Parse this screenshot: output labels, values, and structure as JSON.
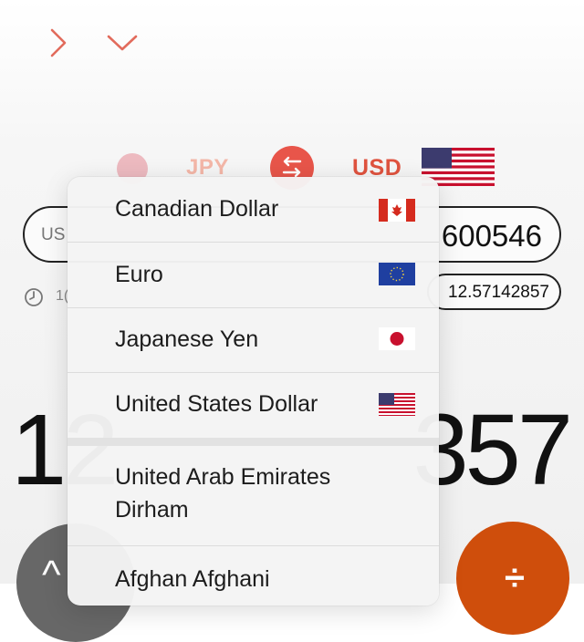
{
  "nav": {
    "forward_icon": "chevron-right-icon",
    "expand_icon": "chevron-down-icon"
  },
  "converter": {
    "from_code": "JPY",
    "to_code": "USD",
    "swap_icon": "swap-arrows-icon",
    "amount_prefix": "US",
    "amount_value": "600546",
    "rate_prefix": "1(",
    "rate_value": "12.57142857",
    "big_left": "12",
    "big_right": "357"
  },
  "dropdown": {
    "items": [
      {
        "label": "Canadian Dollar",
        "flag": "canada-flag-icon"
      },
      {
        "label": "Euro",
        "flag": "eu-flag-icon"
      },
      {
        "label": "Japanese Yen",
        "flag": "japan-flag-icon"
      },
      {
        "label": "United States Dollar",
        "flag": "us-flag-icon"
      },
      {
        "label": "United Arab Emirates Dirham",
        "flag": ""
      },
      {
        "label": "Afghan Afghani",
        "flag": ""
      }
    ]
  },
  "colors": {
    "accent": "#e8554a",
    "accent_text": "#e0533f",
    "orange_button": "#cf4e0c",
    "gray_button": "#676767"
  }
}
